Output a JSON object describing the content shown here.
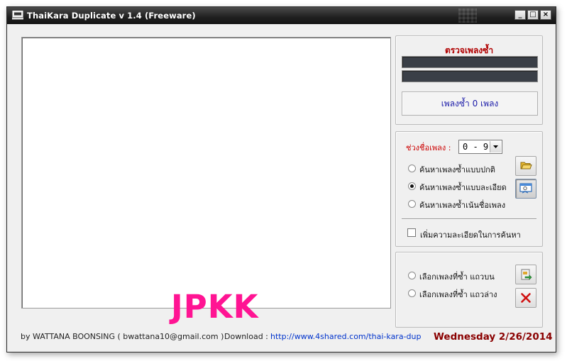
{
  "window": {
    "title": "ThaiKara Duplicate v 1.4  (Freeware)",
    "controls": {
      "minimize": "_",
      "maximize": "□",
      "close": "×"
    }
  },
  "watermark": "JPKK",
  "scan_panel": {
    "title": "ตรวจเพลงซ้ำ",
    "progress_top": 0,
    "progress_bottom": 0,
    "duplicate_count_text": "เพลงซ้ำ  0  เพลง"
  },
  "search_panel": {
    "range_label": "ช่วงชื่อเพลง :",
    "range_value": "0 - 9",
    "options": [
      {
        "label": "ค้นหาเพลงซ้ำแบบปกติ",
        "selected": false
      },
      {
        "label": "ค้นหาเพลงซ้ำแบบละเอียด",
        "selected": true
      },
      {
        "label": "ค้นหาเพลงซ้ำเน้นชื่อเพลง",
        "selected": false
      }
    ],
    "detail_checkbox_label": "เพิ่มความละเอียดในการค้นหา",
    "detail_checked": false
  },
  "select_panel": {
    "options": [
      {
        "label": "เลือกเพลงที่ซ้ำ แถวบน",
        "selected": false
      },
      {
        "label": "เลือกเพลงที่ซ้ำ แถวล่าง",
        "selected": false
      }
    ]
  },
  "icons": {
    "app": "karaoke-app-icon",
    "open": "folder-open-icon",
    "scan": "search-window-icon",
    "apply": "document-arrow-icon",
    "delete": "red-x-icon"
  },
  "colors": {
    "accent_red": "#b00000",
    "link_blue": "#0033cc",
    "date_color": "#8a0000",
    "watermark": "#ff1493"
  },
  "status_bar": {
    "author": "by WATTANA  BOONSING  ( bwattana10@gmail.com )",
    "download_label": "Download :",
    "download_url": "http://www.4shared.com/thai-kara-dup",
    "date": "Wednesday 2/26/2014"
  }
}
